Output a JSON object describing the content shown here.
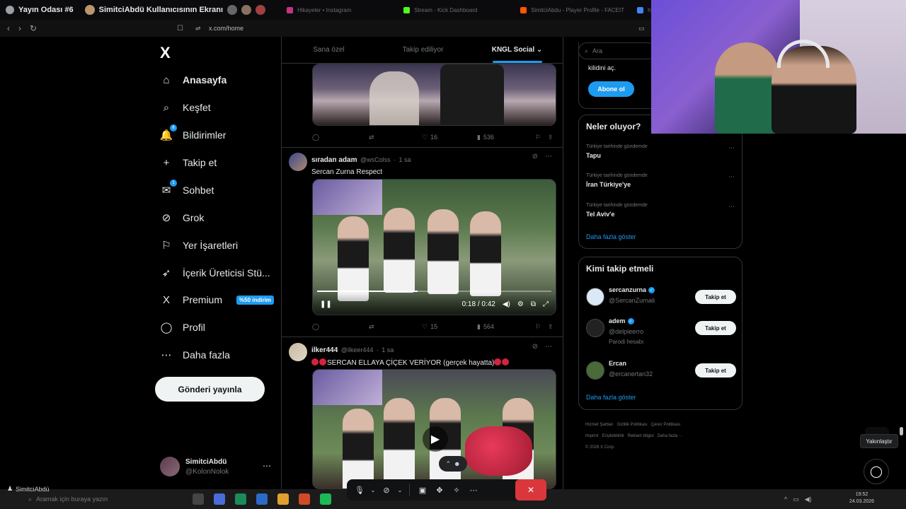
{
  "topbar": {
    "room_name": "Yayın Odası #6",
    "screen_title": "SimitciAbdü Kullanıcısının Ekranı"
  },
  "browser_tabs": [
    {
      "label": "Hikayeler • Instagram",
      "color": "#c13584"
    },
    {
      "label": "Stream - Kick Dashboard",
      "color": "#53fc18"
    },
    {
      "label": "SimitciAbdu - Player Profile - FACEIT",
      "color": "#ff5500"
    },
    {
      "label": "hyeung oh - Google",
      "color": "#4285f4"
    }
  ],
  "address": {
    "url": "x.com/home"
  },
  "sidebar": {
    "logo": "X",
    "items": [
      {
        "label": "Anasayfa",
        "icon": "⌂",
        "active": true
      },
      {
        "label": "Keşfet",
        "icon": "⌕"
      },
      {
        "label": "Bildirimler",
        "icon": "🔔",
        "badge": "6"
      },
      {
        "label": "Takip et",
        "icon": "+"
      },
      {
        "label": "Sohbet",
        "icon": "✉",
        "badge": "1"
      },
      {
        "label": "Grok",
        "icon": "⊘"
      },
      {
        "label": "Yer İşaretleri",
        "icon": "⚐"
      },
      {
        "label": "İçerik Üreticisi Stü...",
        "icon": "➶"
      },
      {
        "label": "Premium",
        "icon": "X",
        "promo": "%50 indirim"
      },
      {
        "label": "Profil",
        "icon": "◯"
      },
      {
        "label": "Daha fazla",
        "icon": "⋯"
      }
    ],
    "post_button": "Gönderi yayınla",
    "account": {
      "name": "SimitciAbdü",
      "handle": "@KolonNolok",
      "more": "⋯"
    }
  },
  "feed": {
    "tabs": [
      "Sana özel",
      "Takip ediliyor",
      "KNGL Social ⌄"
    ],
    "active_tab": 2,
    "post1": {
      "reply_count": "",
      "retweet_count": "",
      "likes": "16",
      "views": "536"
    },
    "post2": {
      "name": "sıradan adam",
      "handle": "@wsColss",
      "time": "1 sa",
      "text": "Sercan Zurna Respect",
      "video_time": "0:18 / 0:42",
      "video_progress": 0.43,
      "likes": "15",
      "views": "564"
    },
    "post3": {
      "name": "ilker444",
      "handle": "@ilkeer444",
      "time": "1 sa",
      "text": "SERCAN ELLAYA ÇİÇEK VERİYOR  (gerçek hayatta)"
    }
  },
  "right": {
    "search_placeholder": "Ara",
    "premium": {
      "text": "kilidini aç.",
      "button": "Abone ol"
    },
    "trends_title": "Neler oluyor?",
    "trends": [
      {
        "context": "Türkiye tarihinde gündemde",
        "title": "Tapu"
      },
      {
        "context": "Türkiye tarihinde gündemde",
        "title": "İran Türkiye'ye"
      },
      {
        "context": "Türkiye tarihinde gündemde",
        "title": "Tel Aviv'e"
      }
    ],
    "trends_more": "Daha fazla göster",
    "who_title": "Kimi takip etmeli",
    "who": [
      {
        "name": "sercanzurna",
        "handle": "@SercanZurnali",
        "verified": true,
        "button": "Takip et",
        "extra": ""
      },
      {
        "name": "adem",
        "handle": "@delpieerro",
        "verified": true,
        "button": "Takip et",
        "extra": "Parodi hesabı"
      },
      {
        "name": "Ercan",
        "handle": "@ercanertan32",
        "verified": false,
        "button": "Takip et",
        "extra": ""
      }
    ],
    "who_more": "Daha fazla göster",
    "footer": [
      "Hizmet Şartları",
      "Gizlilik Politikası",
      "Çerez Politikası",
      "Imprint",
      "Erişilebilirlik",
      "Reklam bilgisi",
      "Daha fazla ···",
      "© 2026 X Corp."
    ]
  },
  "overlay": {
    "zoom_tooltip": "Yakınlaştır",
    "streamer": "SimitciAbdü",
    "taskbar_search": "Aramak için buraya yazın",
    "clock_time": "19:52",
    "clock_date": "24.03.2026"
  },
  "colors": {
    "accent": "#1d9bf0",
    "end_call": "#da373c"
  }
}
